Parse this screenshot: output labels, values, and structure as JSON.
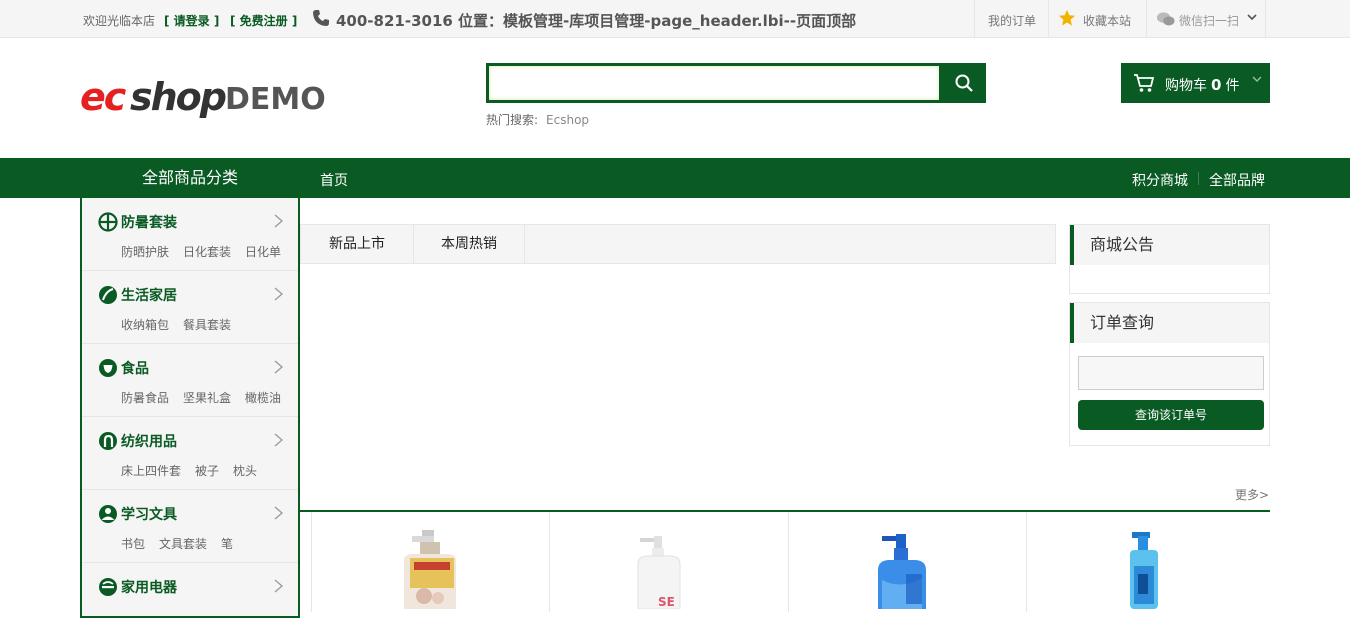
{
  "topbar": {
    "welcome": "欢迎光临本店",
    "login": "[ 请登录 ]",
    "register": "[ 免费注册 ]",
    "phone_info": "400-821-3016 位置：模板管理-库项目管理-page_header.lbi--页面顶部",
    "my_orders": "我的订单",
    "favorite": "收藏本站",
    "wechat": "微信扫一扫"
  },
  "logo": {
    "part1": "ec",
    "part2": "shop",
    "demo": "DEMO"
  },
  "search": {
    "value": "",
    "placeholder": "",
    "hot_label": "热门搜索:",
    "hot_keyword": "Ecshop"
  },
  "cart": {
    "prefix": "购物车",
    "count": "0",
    "suffix": "件"
  },
  "nav": {
    "all_categories": "全部商品分类",
    "home": "首页",
    "points_mall": "积分商城",
    "all_brands": "全部品牌"
  },
  "categories": [
    {
      "name": "防暑套装",
      "subs": [
        "防晒护肤",
        "日化套装",
        "日化单"
      ]
    },
    {
      "name": "生活家居",
      "subs": [
        "收纳箱包",
        "餐具套装"
      ]
    },
    {
      "name": "食品",
      "subs": [
        "防暑食品",
        "坚果礼盒",
        "橄榄油"
      ]
    },
    {
      "name": "纺织用品",
      "subs": [
        "床上四件套",
        "被子",
        "枕头"
      ]
    },
    {
      "name": "学习文具",
      "subs": [
        "书包",
        "文具套装",
        "笔"
      ]
    },
    {
      "name": "家用电器",
      "subs": []
    }
  ],
  "tabs": [
    "新品上市",
    "本周热销"
  ],
  "notice": {
    "title": "商城公告"
  },
  "order_query": {
    "title": "订单查询",
    "button": "查询该订单号"
  },
  "more": "更多>",
  "colors": {
    "brand_green": "#0a5a23",
    "logo_red": "#e52020"
  }
}
